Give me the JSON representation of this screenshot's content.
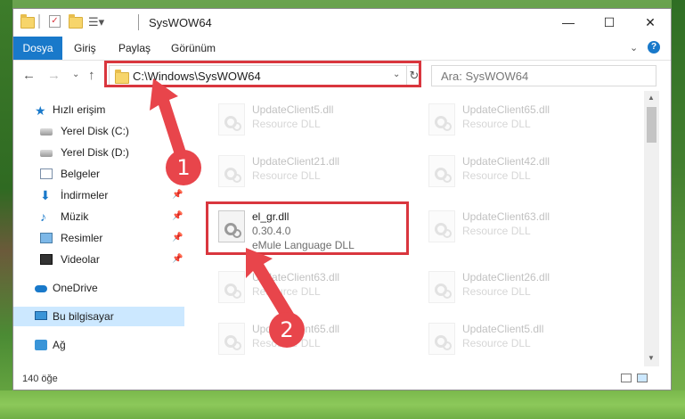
{
  "window": {
    "title": "SysWOW64",
    "controls": {
      "minimize": "—",
      "maximize": "☐",
      "close": "✕"
    }
  },
  "ribbon": {
    "tabs": [
      {
        "label": "Dosya",
        "active": true
      },
      {
        "label": "Giriş"
      },
      {
        "label": "Paylaş"
      },
      {
        "label": "Görünüm"
      }
    ],
    "expand": "⌄",
    "help": "?"
  },
  "nav": {
    "back": "←",
    "forward": "→",
    "recent": "⌄",
    "up": "↑",
    "address": "C:\\Windows\\SysWOW64",
    "address_dropdown": "⌄",
    "refresh": "↻",
    "search_placeholder": "Ara: SysWOW64"
  },
  "sidebar": {
    "items": [
      {
        "label": "Hızlı erişim",
        "icon": "star-icon"
      },
      {
        "label": "Yerel Disk (C:)",
        "icon": "drive-icon"
      },
      {
        "label": "Yerel Disk (D:)",
        "icon": "drive-icon"
      },
      {
        "label": "Belgeler",
        "icon": "documents-icon"
      },
      {
        "label": "İndirmeler",
        "icon": "download-icon",
        "pin": "📌"
      },
      {
        "label": "Müzik",
        "icon": "music-icon",
        "pin": "📌"
      },
      {
        "label": "Resimler",
        "icon": "pictures-icon",
        "pin": "📌"
      },
      {
        "label": "Videolar",
        "icon": "videos-icon",
        "pin": "📌"
      },
      {
        "label": "OneDrive",
        "icon": "cloud-icon"
      },
      {
        "label": "Bu bilgisayar",
        "icon": "computer-icon",
        "selected": true
      },
      {
        "label": "Ağ",
        "icon": "network-icon"
      }
    ]
  },
  "files": {
    "left_col": [
      {
        "name": "UpdateClient5.dll",
        "type": "Resource DLL"
      },
      {
        "name": "UpdateClient21.dll",
        "type": "Resource DLL"
      },
      {
        "name": "el_gr.dll",
        "version": "0.30.4.0",
        "type": "eMule Language DLL",
        "selected": true
      },
      {
        "name": "UpdateClient63.dll",
        "type": "Resource DLL"
      },
      {
        "name": "UpdateClient65.dll",
        "type": "Resource DLL"
      }
    ],
    "right_col": [
      {
        "name": "UpdateClient65.dll",
        "type": "Resource DLL"
      },
      {
        "name": "UpdateClient42.dll",
        "type": "Resource DLL"
      },
      {
        "name": "UpdateClient63.dll",
        "type": "Resource DLL"
      },
      {
        "name": "UpdateClient26.dll",
        "type": "Resource DLL"
      },
      {
        "name": "UpdateClient5.dll",
        "type": "Resource DLL"
      }
    ]
  },
  "status": {
    "count": "140 öğe"
  },
  "annotations": {
    "step1": "1",
    "step2": "2",
    "highlight_color": "#d9363e",
    "badge_color": "#e8454b"
  }
}
